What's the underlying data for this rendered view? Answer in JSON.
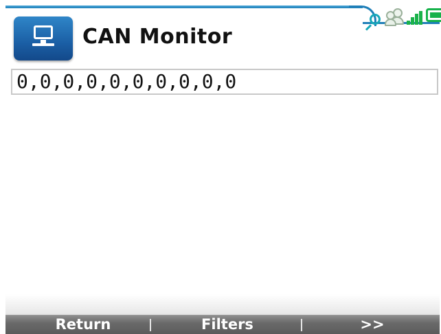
{
  "header": {
    "title": "CAN Monitor",
    "app_icon": "monitor-icon"
  },
  "status_bar": {
    "icons": [
      "search-icon",
      "users-icon",
      "signal-icon",
      "battery-icon"
    ],
    "accent_color": "#1f7fb8",
    "status_color": "#16b24a"
  },
  "data_field": {
    "value": "0,0,0,0,0,0,0,0,0,0"
  },
  "softkeys": [
    {
      "label": "Return"
    },
    {
      "label": "Filters"
    },
    {
      "label": ">>"
    }
  ]
}
